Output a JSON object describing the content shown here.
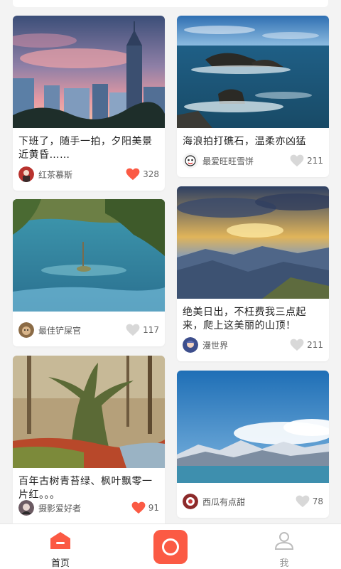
{
  "colors": {
    "accent": "#fb5a44",
    "heart_liked": "#fb5a44",
    "heart_default": "#d8d8d8"
  },
  "posts": [
    {
      "title": "下班了，随手一拍，夕阳美景近黄昏……",
      "author": "红茶慕斯",
      "likes": "328",
      "liked": true,
      "image": "city-sunset"
    },
    {
      "title": "海浪拍打礁石，温柔亦凶猛",
      "author": "最爱旺旺雪饼",
      "likes": "211",
      "liked": false,
      "image": "sea-rocks"
    },
    {
      "title": "",
      "author": "最佳铲屎官",
      "likes": "117",
      "liked": false,
      "image": "blue-lake"
    },
    {
      "title": "绝美日出，不枉费我三点起来，爬上这美丽的山顶！",
      "author": "漫世界",
      "likes": "211",
      "liked": false,
      "image": "mountain-sunrise"
    },
    {
      "title": "百年古树青苔绿、枫叶飘零一片红。。。",
      "author": "摄影爱好者",
      "likes": "91",
      "liked": true,
      "image": "mossy-forest"
    },
    {
      "title": "",
      "author": "西瓜有点甜",
      "likes": "78",
      "liked": false,
      "image": "snow-mountains-lake"
    }
  ],
  "tabbar": {
    "home_label": "首页",
    "me_label": "我",
    "home_icon": "home-icon",
    "camera_icon": "camera-icon",
    "me_icon": "user-icon"
  }
}
